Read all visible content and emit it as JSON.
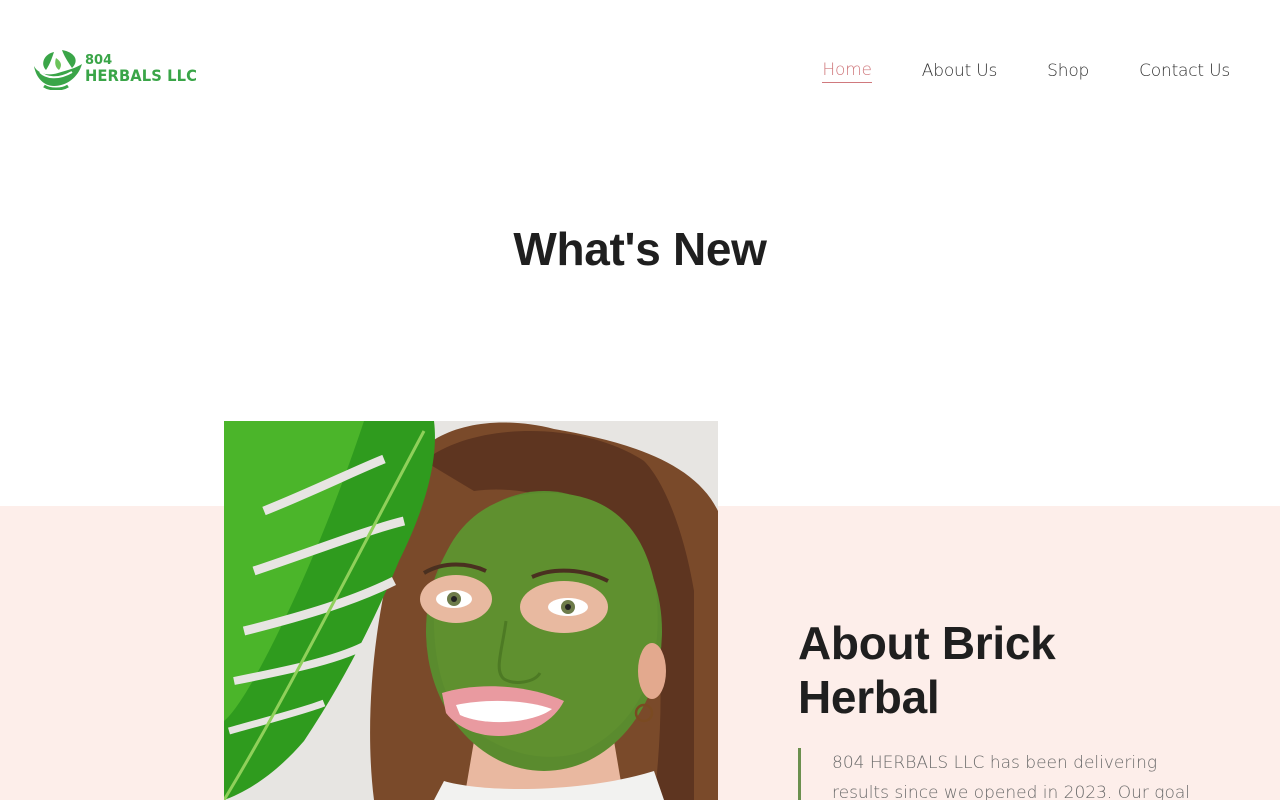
{
  "brand": {
    "number": "804",
    "name": "HERBALS LLC",
    "color": "#3aa548",
    "icon": "leaf-mortar-logo-icon"
  },
  "nav": {
    "items": [
      {
        "label": "Home",
        "active": true
      },
      {
        "label": "About Us",
        "active": false
      },
      {
        "label": "Shop",
        "active": false
      },
      {
        "label": "Contact Us",
        "active": false
      }
    ],
    "active_color": "#d0797d"
  },
  "whats_new": {
    "heading": "What's New"
  },
  "about": {
    "heading": "About Brick Herbal",
    "body": "804 HERBALS LLC has been delivering results since we opened in 2023. Our goal",
    "band_color": "#fdeeea",
    "quote_bar_color": "#6b8f4e"
  },
  "hero_image": {
    "description_icon": "woman-green-face-mask-image"
  }
}
